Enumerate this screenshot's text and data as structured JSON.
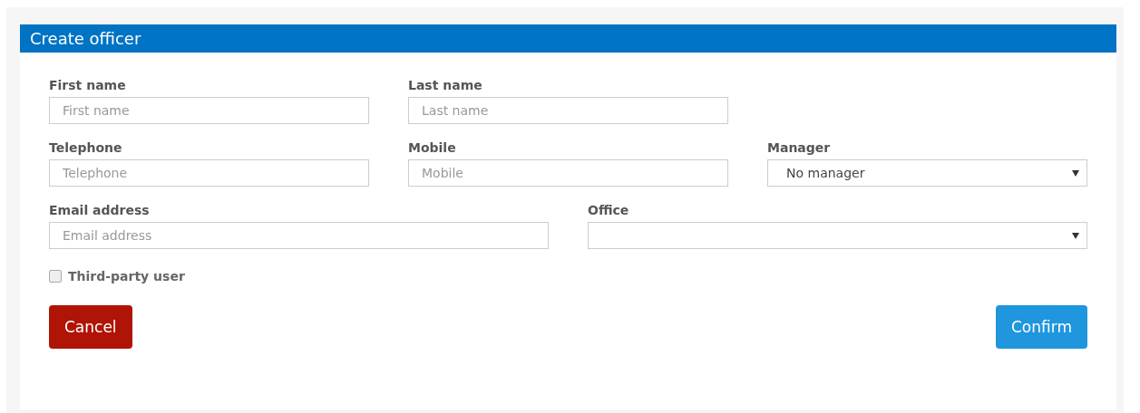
{
  "title": "Create officer",
  "rows": [
    {
      "fields": [
        {
          "kind": "text",
          "label": "First name",
          "placeholder": "First name"
        },
        {
          "kind": "text",
          "label": "Last name",
          "placeholder": "Last name"
        }
      ]
    },
    {
      "fields": [
        {
          "kind": "text",
          "label": "Telephone",
          "placeholder": "Telephone"
        },
        {
          "kind": "text",
          "label": "Mobile",
          "placeholder": "Mobile"
        },
        {
          "kind": "select",
          "label": "Manager",
          "value": "No manager"
        }
      ]
    },
    {
      "fields": [
        {
          "kind": "text",
          "label": "Email address",
          "placeholder": "Email address"
        },
        {
          "kind": "select",
          "label": "Office"
        }
      ]
    }
  ],
  "checkbox": {
    "label": "Third-party user",
    "checked": false
  },
  "buttons": [
    {
      "kind": "cancel",
      "label": "Cancel"
    },
    {
      "kind": "confirm",
      "label": "Confirm"
    }
  ]
}
